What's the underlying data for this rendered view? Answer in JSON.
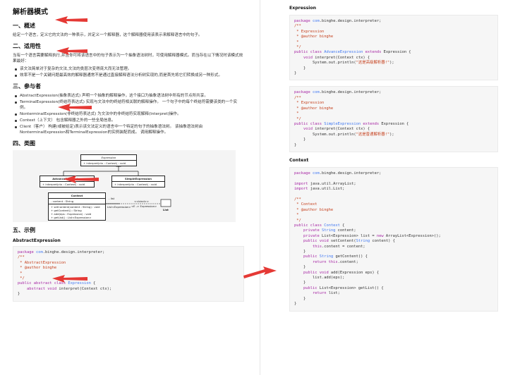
{
  "colors": {
    "arrow": "#e53935",
    "keyword": "#a626a4",
    "type": "#4078f2",
    "comment": "#c5401d"
  },
  "doc": {
    "title": "解析器模式",
    "sections": {
      "overview": {
        "heading": "一、概述",
        "text": "给定一个语言，定义它的文法的一种表示，并定义一个解释器，这个解释器使用该表示来解释语言中的句子。"
      },
      "applicability": {
        "heading": "二、适用性",
        "text": "当有一个语言需要解释执行,并且你可将该语言中的句子表示为一个抽象语法树时，可使用解释器模式。而当存在以下情况时该模式效果最好：",
        "bullets": [
          "该文法简单对于复杂的文法,文法的类层次变得庞大而无法管理。",
          "效率不是一个关键问题最高效的解释器通常不是通过直接解释语法分析树实现的,而是首先将它们转换成另一种形式。"
        ]
      },
      "participants": {
        "heading": "三、参与者",
        "bullets": [
          "AbstractExpression(抽象表达式) 声明一个抽象的解释操作，这个接口为抽象语法树中所有的节点所共享。",
          "TerminalExpression(终结符表达式) 实现与文法中的终结符相关联的解释操作。 一个句子中的每个终结符需要该类的一个实例。",
          "NonterminalExpression(非终结符表达式) 为文法中的非终结符实现解释(Interpret)操作。",
          "Context（上下文） 包含解释器之外的一些全局信息。",
          "Client（客户） 构建(或被给定)表示该文法定义的语言中一个特定的句子的抽象语法树。 该抽象语法树由NonterminalExpression和TerminalExpression的实例装配而成。 调用解释操作。"
        ]
      },
      "class_diagram": {
        "heading": "四、类图",
        "expression": {
          "name": "Expression",
          "method": "+ interpret(ctx : Context) : void"
        },
        "advance": {
          "name": "AdvanceExpression",
          "method": "+ interpret(ctx : Context) : void"
        },
        "simple": {
          "name": "SimpleExpression",
          "method": "+ interpret(ctx : Context) : void"
        },
        "context": {
          "name": "Context",
          "field": "- content : String",
          "methods": [
            "+ setContent(content : String) : void",
            "+ getContent() : String",
            "+ add(eps : Expression) : void",
            "+ getList() : List<Expression>"
          ]
        },
        "list_class": "List",
        "assoc_label_1": "- list",
        "assoc_label_2": "List<Expression>",
        "assoc_label_3": "<<bind>>",
        "assoc_label_4": "<E -> Expression>"
      },
      "example": {
        "heading": "五、示例",
        "sub": "AbstractExpression"
      }
    }
  },
  "right": {
    "expression_heading": "Expression",
    "context_heading": "Context"
  }
}
